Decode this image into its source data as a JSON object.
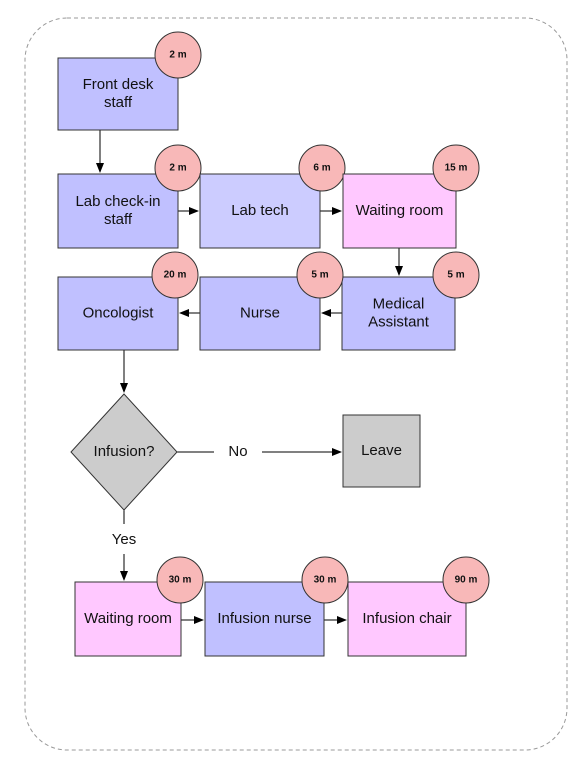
{
  "colors": {
    "staff": "#c0c0ff",
    "lab_tech": "#ccccff",
    "waiting": "#ffc8ff",
    "decision": "#cccccc",
    "badge": "#f8b8b8",
    "border": "#999999"
  },
  "nodes": [
    {
      "id": "front-desk",
      "lines": [
        "Front desk",
        "staff"
      ],
      "time": "2 m",
      "color": "staff"
    },
    {
      "id": "lab-checkin",
      "lines": [
        "Lab check-in",
        "staff"
      ],
      "time": "2 m",
      "color": "staff"
    },
    {
      "id": "lab-tech",
      "lines": [
        "Lab tech"
      ],
      "time": "6 m",
      "color": "lab_tech"
    },
    {
      "id": "waiting-room-1",
      "lines": [
        "Waiting room"
      ],
      "time": "15 m",
      "color": "waiting"
    },
    {
      "id": "medical-assistant",
      "lines": [
        "Medical",
        "Assistant"
      ],
      "time": "5 m",
      "color": "staff"
    },
    {
      "id": "nurse",
      "lines": [
        "Nurse"
      ],
      "time": "5 m",
      "color": "staff"
    },
    {
      "id": "oncologist",
      "lines": [
        "Oncologist"
      ],
      "time": "20 m",
      "color": "staff"
    },
    {
      "id": "leave",
      "lines": [
        "Leave"
      ],
      "color": "decision"
    },
    {
      "id": "waiting-room-2",
      "lines": [
        "Waiting room"
      ],
      "time": "30 m",
      "color": "waiting"
    },
    {
      "id": "infusion-nurse",
      "lines": [
        "Infusion nurse"
      ],
      "time": "30 m",
      "color": "staff"
    },
    {
      "id": "infusion-chair",
      "lines": [
        "Infusion chair"
      ],
      "time": "90 m",
      "color": "waiting"
    }
  ],
  "decision": {
    "label": "Infusion?",
    "no_label": "No",
    "yes_label": "Yes"
  }
}
